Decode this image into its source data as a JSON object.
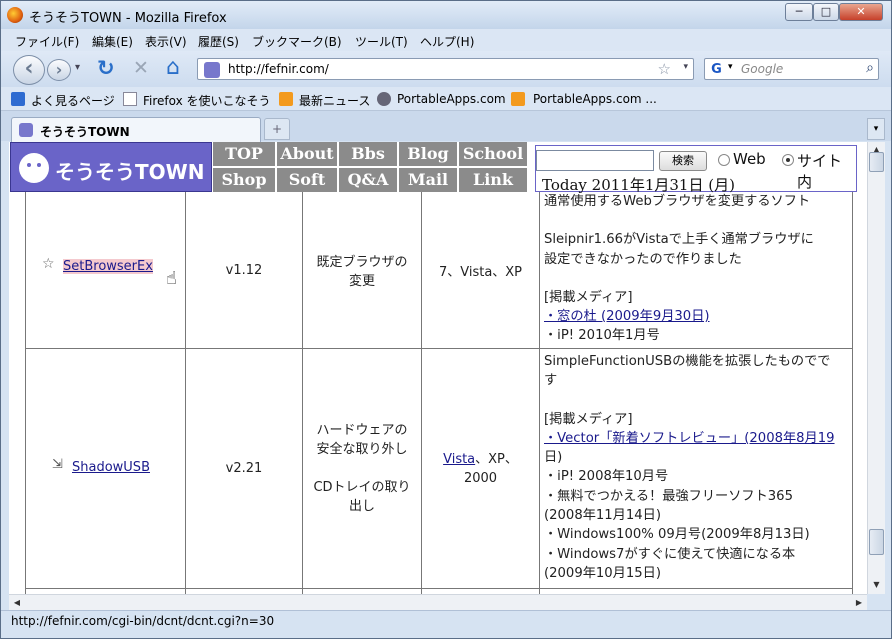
{
  "window": {
    "title": "そうそうTOWN - Mozilla Firefox",
    "min": "─",
    "max": "□",
    "close": "✕"
  },
  "menu": [
    "ファイル(F)",
    "編集(E)",
    "表示(V)",
    "履歴(S)",
    "ブックマーク(B)",
    "ツール(T)",
    "ヘルプ(H)"
  ],
  "nav": {
    "url": "http://fefnir.com/",
    "search_placeholder": "Google",
    "back": "‹",
    "forward": "›",
    "dropdown": "▾",
    "reload": "↻",
    "stop": "✕",
    "home": "⌂"
  },
  "bookmarks": [
    "よく見るページ",
    "Firefox を使いこなそう",
    "最新ニュース",
    "PortableApps.com",
    "PortableApps.com ..."
  ],
  "tab": {
    "title": "そうそうTOWN",
    "new": "+"
  },
  "status": "http://fefnir.com/cgi-bin/dcnt/dcnt.cgi?n=30",
  "site": {
    "logo_text": "そうそうTOWN",
    "nav_top": [
      "TOP",
      "About",
      "Bbs",
      "Blog",
      "School"
    ],
    "nav_bottom": [
      "Shop",
      "Soft",
      "Q&A",
      "Mail",
      "Link"
    ],
    "search_button": "検索",
    "radio_web": "Web",
    "radio_site": "サイト内",
    "today": "Today 2011年1月31日 (月)"
  },
  "rows": [
    {
      "name": "SetBrowserEx",
      "version": "v1.12",
      "purpose": [
        "既定ブラウザの",
        "変更"
      ],
      "os": "7、Vista、XP",
      "desc": [
        "通常使用するWebブラウザを変更するソフト",
        "",
        "Sleipnir1.66がVistaで上手く通常ブラウザに",
        "設定できなかったので作りました",
        "",
        "[掲載メディア]",
        "・窓の杜 (2009年9月30日)",
        "・iP! 2010年1月号"
      ]
    },
    {
      "name": "ShadowUSB",
      "version": "v2.21",
      "purpose": [
        "ハードウェアの",
        "安全な取り外し",
        "",
        "CDトレイの取り",
        "出し"
      ],
      "os_link": "Vista",
      "os_rest": "、XP、",
      "os_line2": "2000",
      "desc": [
        "SimpleFunctionUSBの機能を拡張したものでで",
        "す",
        "",
        "[掲載メディア]",
        "・Vector「新着ソフトレビュー」(2008年8月19",
        "日)",
        "・iP! 2008年10月号",
        "・無料でつかえる！最強フリーソフト365",
        "(2008年11月14日)",
        "・Windows100% 09月号(2009年8月13日)",
        "・Windows7がすぐに使えて快適になる本",
        "(2009年10月15日)"
      ]
    }
  ]
}
